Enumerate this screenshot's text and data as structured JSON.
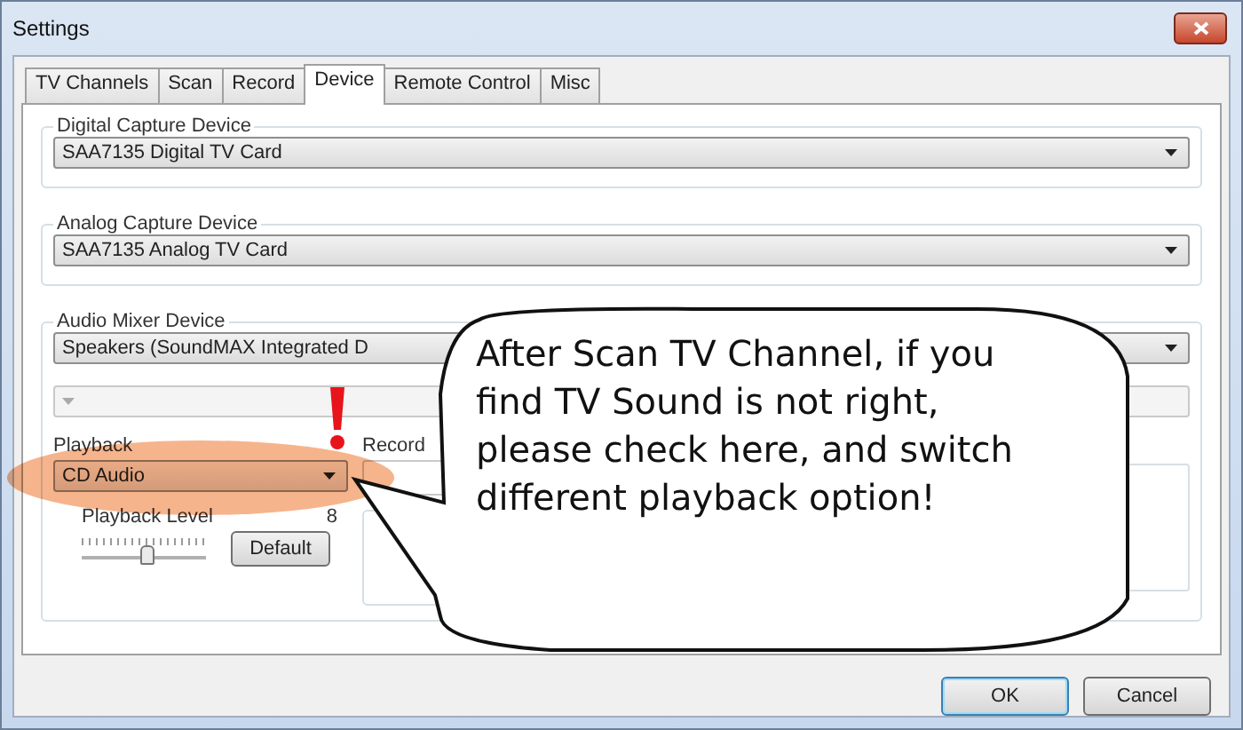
{
  "window": {
    "title": "Settings"
  },
  "tabs": [
    {
      "label": "TV Channels",
      "selected": false
    },
    {
      "label": "Scan",
      "selected": false
    },
    {
      "label": "Record",
      "selected": false
    },
    {
      "label": "Device",
      "selected": true
    },
    {
      "label": "Remote Control",
      "selected": false
    },
    {
      "label": "Misc",
      "selected": false
    }
  ],
  "digital_capture_device": {
    "title": "Digital Capture Device",
    "value": "SAA7135 Digital TV Card"
  },
  "analog_capture_device": {
    "title": "Analog Capture Device",
    "value": "SAA7135 Analog TV Card"
  },
  "audio_mixer_device": {
    "title": "Audio Mixer Device",
    "value": "Speakers (SoundMAX Integrated D",
    "line_combo_disabled": true,
    "playback": {
      "label": "Playback",
      "value": "CD Audio",
      "level_title": "Playback Level",
      "level_reading": "8",
      "level": 0.53,
      "default_button": "Default"
    },
    "record": {
      "label": "Record"
    }
  },
  "annotation": {
    "text": "After Scan TV Channel, if you find TV Sound is not right, please check here, and switch different playback option!"
  },
  "buttons": [
    {
      "label": "OK",
      "selected": true
    },
    {
      "label": "Cancel",
      "selected": false
    }
  ]
}
